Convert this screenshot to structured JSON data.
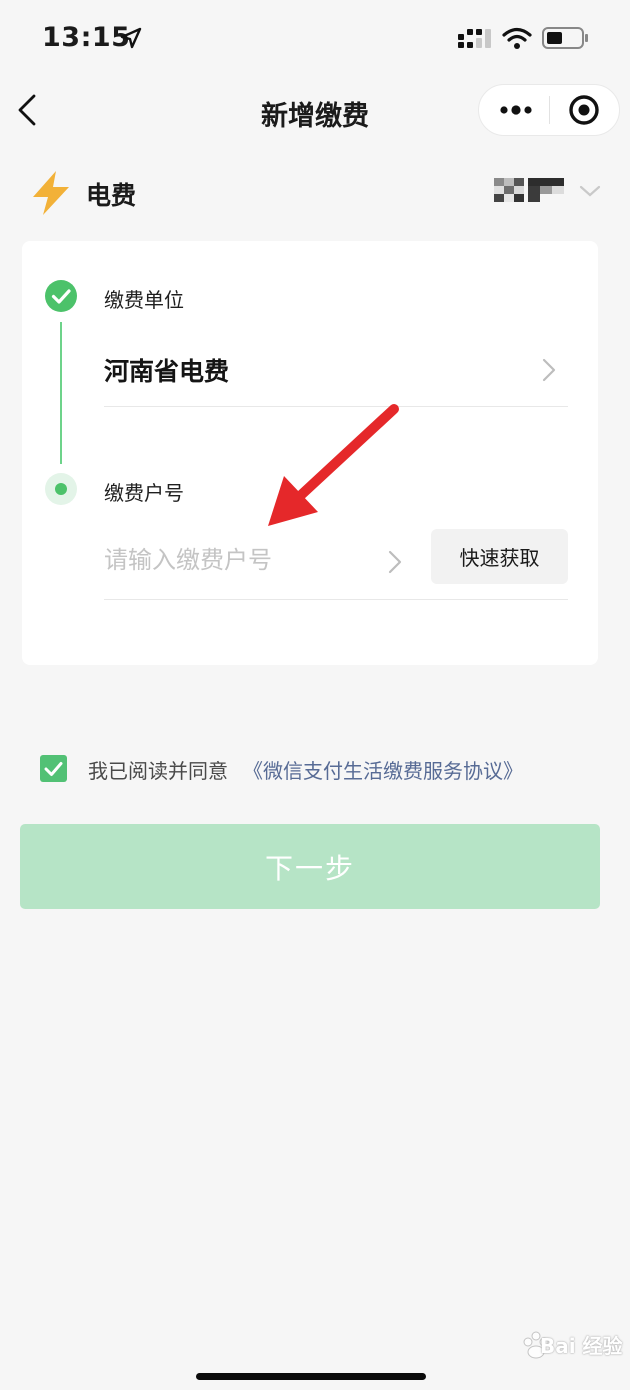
{
  "status_bar": {
    "time": "13:15"
  },
  "nav": {
    "title": "新增缴费"
  },
  "category": {
    "label": "电费",
    "icon": "lightning-icon",
    "accent": "#f2b138"
  },
  "steps": {
    "unit": {
      "label": "缴费单位",
      "value": "河南省电费"
    },
    "account": {
      "label": "缴费户号",
      "placeholder": "请输入缴费户号",
      "quick_button": "快速获取"
    }
  },
  "agreement": {
    "checked": true,
    "text": "我已阅读并同意",
    "link": "《微信支付生活缴费服务协议》"
  },
  "next_button": {
    "label": "下一步"
  },
  "watermark": {
    "text": "Bai 经验"
  },
  "colors": {
    "primary_green": "#52c175",
    "primary_disabled": "#b6e4c6",
    "link_blue": "#576b95",
    "annotation_red": "#e5282a"
  }
}
